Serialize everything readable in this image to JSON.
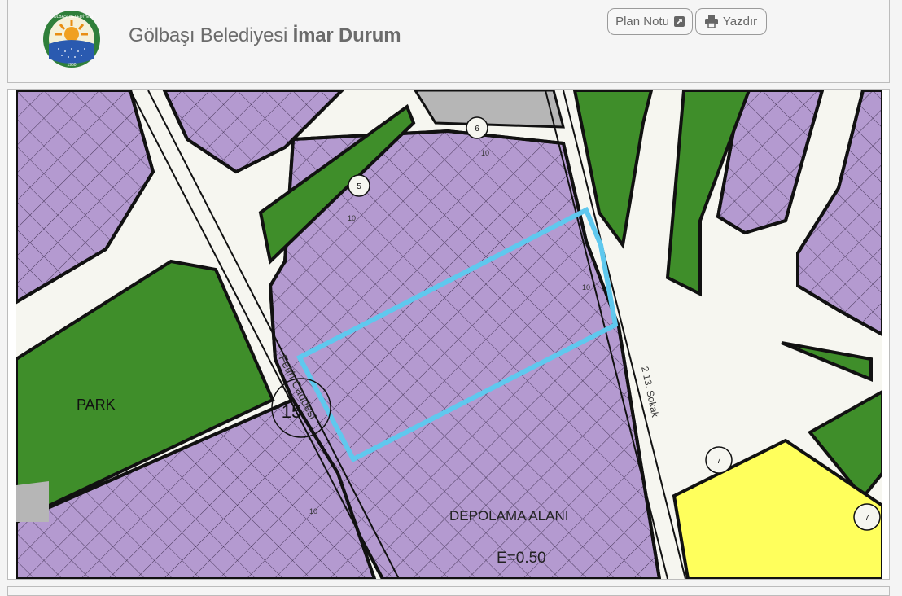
{
  "header": {
    "municipality": "Gölbaşı Belediyesi",
    "page_title": "İmar Durum",
    "logo_top_text": "GÖLBAŞI BELEDİYESİ",
    "logo_year": "1960"
  },
  "toolbar": {
    "plan_note_label": "Plan Notu",
    "plan_note_icon": "external-link-icon",
    "print_label": "Yazdır",
    "print_icon": "printer-icon"
  },
  "map": {
    "labels": {
      "park": "PARK",
      "storage_area": "DEPOLAMA ALANI",
      "density": "E=0.50",
      "street_fetih": "Fetih Caddesi",
      "street_sokak": "2 13. Sokak",
      "road_width_15": "15"
    },
    "road_markers": [
      "6",
      "5",
      "7",
      "7"
    ],
    "elevation_marks": [
      "10",
      "10",
      "10",
      "10"
    ],
    "colors": {
      "residential": "#b49ad0",
      "park": "#3f8e2a",
      "commercial": "#ffff5c",
      "road": "#f6f6f0",
      "parcel_outline": "#5fc8ee",
      "gray_block": "#b6b6b6"
    }
  }
}
